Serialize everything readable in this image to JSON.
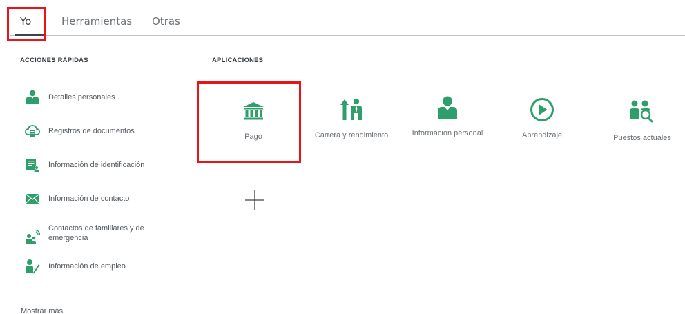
{
  "tabs": {
    "items": [
      "Yo",
      "Herramientas",
      "Otras"
    ],
    "selected": "Yo"
  },
  "quick_actions": {
    "heading": "ACCIONES RÁPIDAS",
    "items": [
      {
        "label": "Detalles personales",
        "icon": "person-icon"
      },
      {
        "label": "Registros de documentos",
        "icon": "cloud-documents-icon"
      },
      {
        "label": "Información de identificación",
        "icon": "id-document-icon"
      },
      {
        "label": "Información de contacto",
        "icon": "envelope-icon"
      },
      {
        "label": "Contactos de familiares y de emergencia",
        "icon": "family-contacts-icon"
      },
      {
        "label": "Información de empleo",
        "icon": "employee-edit-icon"
      }
    ],
    "show_more": "Mostrar más"
  },
  "apps": {
    "heading": "APLICACIONES",
    "items": [
      {
        "label": "Pago",
        "icon": "bank-icon"
      },
      {
        "label": "Carrera y rendimiento",
        "icon": "career-growth-icon"
      },
      {
        "label": "Información personal",
        "icon": "person-icon"
      },
      {
        "label": "Aprendizaje",
        "icon": "play-circle-icon"
      },
      {
        "label": "Puestos actuales",
        "icon": "people-search-icon"
      }
    ],
    "add_icon": "plus-icon"
  },
  "colors": {
    "accent_green": "#2e9e6b",
    "highlight_red": "#e8141a",
    "text": "#555b61",
    "divider": "#b9c4c3"
  }
}
